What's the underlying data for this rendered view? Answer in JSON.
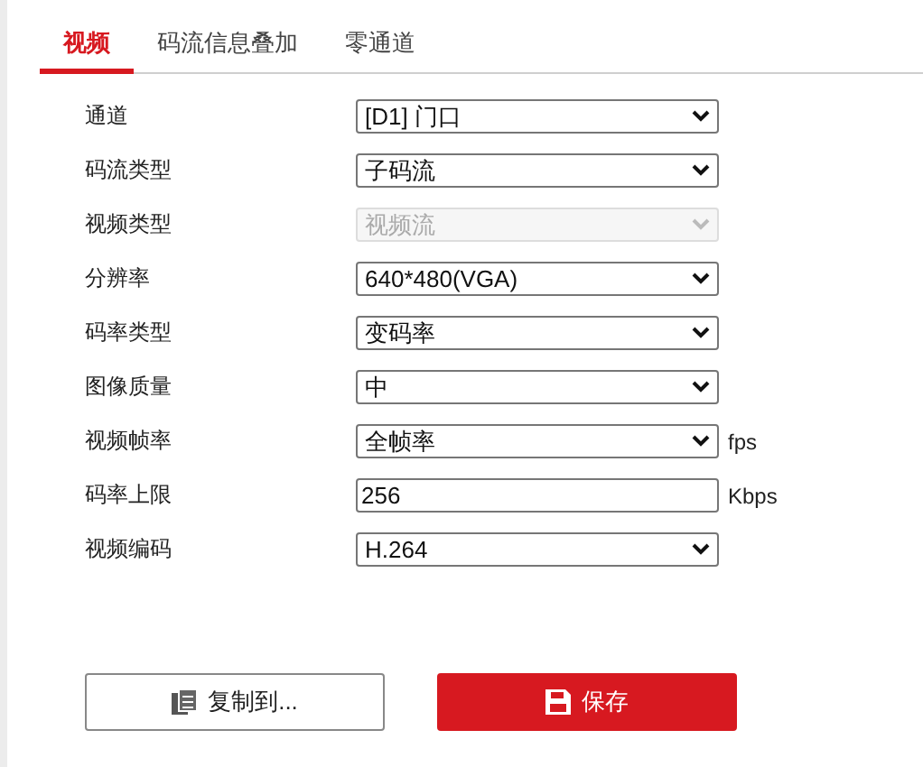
{
  "tabs": [
    {
      "label": "视频",
      "selected": true
    },
    {
      "label": "码流信息叠加",
      "selected": false
    },
    {
      "label": "零通道",
      "selected": false
    }
  ],
  "fields": [
    {
      "label": "通道",
      "kind": "select",
      "value": "[D1] 门口",
      "disabled": false
    },
    {
      "label": "码流类型",
      "kind": "select",
      "value": "子码流",
      "disabled": false
    },
    {
      "label": "视频类型",
      "kind": "select",
      "value": "视频流",
      "disabled": true
    },
    {
      "label": "分辨率",
      "kind": "select",
      "value": "640*480(VGA)",
      "disabled": false
    },
    {
      "label": "码率类型",
      "kind": "select",
      "value": "变码率",
      "disabled": false
    },
    {
      "label": "图像质量",
      "kind": "select",
      "value": "中",
      "disabled": false
    },
    {
      "label": "视频帧率",
      "kind": "select",
      "value": "全帧率",
      "disabled": false,
      "unit": "fps"
    },
    {
      "label": "码率上限",
      "kind": "input",
      "value": "256",
      "disabled": false,
      "unit": "Kbps"
    },
    {
      "label": "视频编码",
      "kind": "select",
      "value": "H.264",
      "disabled": false
    }
  ],
  "buttons": [
    {
      "label": "复制到...",
      "kind": "copy"
    },
    {
      "label": "保存",
      "kind": "save"
    }
  ]
}
